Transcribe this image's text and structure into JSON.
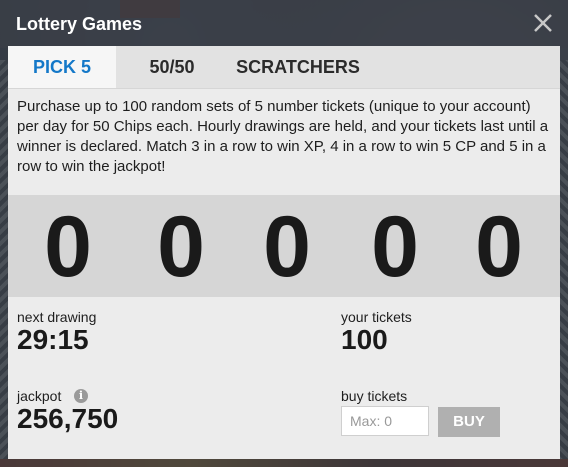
{
  "dialog": {
    "title": "Lottery Games",
    "close_icon": "close-icon"
  },
  "tabs": [
    {
      "label": "PICK 5",
      "active": true
    },
    {
      "label": "50/50",
      "active": false
    },
    {
      "label": "SCRATCHERS",
      "active": false
    }
  ],
  "description": "Purchase up to 100 random sets of 5 number tickets (unique to your account) per day for 50 Chips each. Hourly drawings are held, and your tickets last until a winner is declared. Match 3 in a row to win XP, 4 in a row to win 5 CP and 5 in a row to win the jackpot!",
  "numbers": [
    "0",
    "0",
    "0",
    "0",
    "0"
  ],
  "next_drawing": {
    "label": "next drawing",
    "value": "29:15"
  },
  "your_tickets": {
    "label": "your tickets",
    "value": "100"
  },
  "jackpot": {
    "label": "jackpot",
    "value": "256,750",
    "info_icon": "info-icon"
  },
  "buy_tickets": {
    "label": "buy tickets",
    "placeholder": "Max: 0",
    "button_label": "BUY"
  },
  "colors": {
    "accent": "#1478c8",
    "panel": "#ececec",
    "band": "#d6d6d6",
    "button": "#b0b0b0"
  }
}
